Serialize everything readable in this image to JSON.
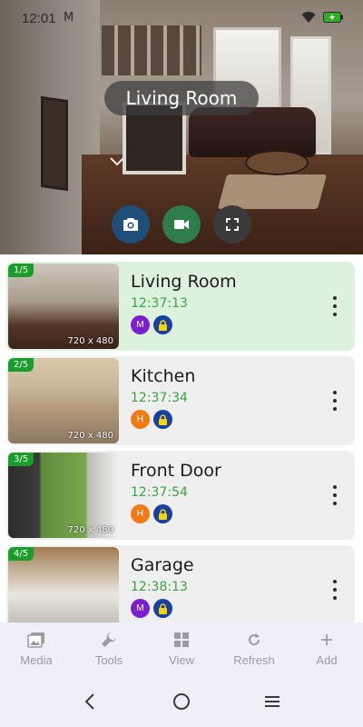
{
  "status_bar": {
    "time": "12:01",
    "notification": "M"
  },
  "live_view": {
    "title": "Living Room"
  },
  "cameras": [
    {
      "counter": "1/5",
      "name": "Living Room",
      "time": "12:37:13",
      "resolution": "720 x 480",
      "mode_badge": "M",
      "active": true
    },
    {
      "counter": "2/5",
      "name": "Kitchen",
      "time": "12:37:34",
      "resolution": "720 x 480",
      "mode_badge": "H",
      "active": false
    },
    {
      "counter": "3/5",
      "name": "Front Door",
      "time": "12:37:54",
      "resolution": "720 x 480",
      "mode_badge": "H",
      "active": false
    },
    {
      "counter": "4/5",
      "name": "Garage",
      "time": "12:38:13",
      "resolution": "",
      "mode_badge": "M",
      "active": false
    }
  ],
  "bottom_nav": {
    "items": [
      {
        "label": "Media",
        "icon": "image-icon"
      },
      {
        "label": "Tools",
        "icon": "wrench-icon"
      },
      {
        "label": "View",
        "icon": "grid-icon"
      },
      {
        "label": "Refresh",
        "icon": "refresh-icon"
      },
      {
        "label": "Add",
        "icon": "plus-icon"
      }
    ]
  },
  "colors": {
    "accent_green": "#3aa346",
    "active_card": "#dcf2dc",
    "badge_m": "#7b1fd1",
    "badge_h": "#ef7a16",
    "badge_lock": "#1a3fa3"
  }
}
